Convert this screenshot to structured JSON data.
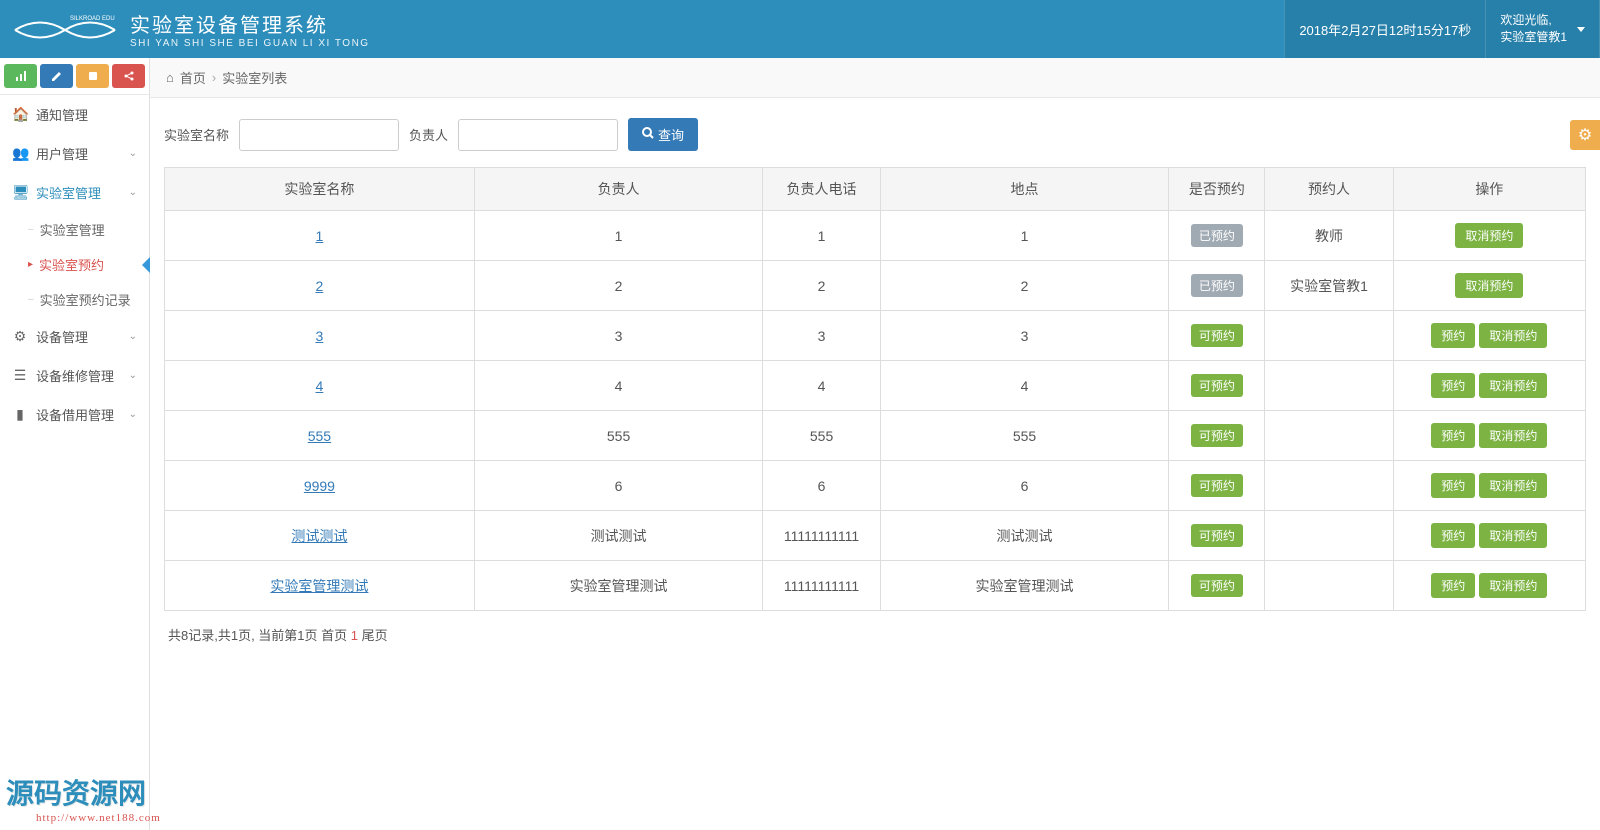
{
  "header": {
    "brand_small": "SILKROAD EDU",
    "title": "实验室设备管理系统",
    "subtitle": "SHI YAN SHI SHE BEI GUAN LI XI TONG",
    "datetime": "2018年2月27日12时15分17秒",
    "welcome": "欢迎光临,",
    "username": "实验室管教1"
  },
  "sidebar": {
    "items": [
      {
        "icon": "🏠",
        "label": "通知管理",
        "expand": false,
        "sub": []
      },
      {
        "icon": "👥",
        "label": "用户管理",
        "expand": true,
        "sub": []
      },
      {
        "icon": "🖥",
        "label": "实验室管理",
        "expand": true,
        "active": true,
        "sub": [
          {
            "label": "实验室管理",
            "active": false
          },
          {
            "label": "实验室预约",
            "active": true
          },
          {
            "label": "实验室预约记录",
            "active": false
          }
        ]
      },
      {
        "icon": "⚙",
        "label": "设备管理",
        "expand": true,
        "sub": []
      },
      {
        "icon": "☰",
        "label": "设备维修管理",
        "expand": true,
        "sub": []
      },
      {
        "icon": "▮",
        "label": "设备借用管理",
        "expand": true,
        "sub": []
      }
    ]
  },
  "breadcrumb": {
    "home": "首页",
    "current": "实验室列表"
  },
  "filter": {
    "label_name": "实验室名称",
    "label_person": "负责人",
    "query": "查询"
  },
  "table": {
    "columns": [
      "实验室名称",
      "负责人",
      "负责人电话",
      "地点",
      "是否预约",
      "预约人",
      "操作"
    ],
    "rows": [
      {
        "name": "1",
        "person": "1",
        "phone": "1",
        "location": "1",
        "reserved": true,
        "reserver": "教师"
      },
      {
        "name": "2",
        "person": "2",
        "phone": "2",
        "location": "2",
        "reserved": true,
        "reserver": "实验室管教1"
      },
      {
        "name": "3",
        "person": "3",
        "phone": "3",
        "location": "3",
        "reserved": false,
        "reserver": ""
      },
      {
        "name": "4",
        "person": "4",
        "phone": "4",
        "location": "4",
        "reserved": false,
        "reserver": ""
      },
      {
        "name": "555",
        "person": "555",
        "phone": "555",
        "location": "555",
        "reserved": false,
        "reserver": ""
      },
      {
        "name": "9999",
        "person": "6",
        "phone": "6",
        "location": "6",
        "reserved": false,
        "reserver": ""
      },
      {
        "name": "测试测试",
        "person": "测试测试",
        "phone": "11111111111",
        "location": "测试测试",
        "reserved": false,
        "reserver": ""
      },
      {
        "name": "实验室管理测试",
        "person": "实验室管理测试",
        "phone": "11111111111",
        "location": "实验室管理测试",
        "reserved": false,
        "reserver": ""
      }
    ]
  },
  "status_labels": {
    "reserved": "已预约",
    "available": "可预约"
  },
  "action_labels": {
    "reserve": "预约",
    "cancel": "取消预约"
  },
  "pagination": {
    "text_prefix": "共8记录,共1页, 当前第1页 首页 ",
    "text_mid": "1",
    "text_suffix": " 尾页"
  },
  "watermark": {
    "title": "源码资源网",
    "url": "http://www.net188.com"
  }
}
